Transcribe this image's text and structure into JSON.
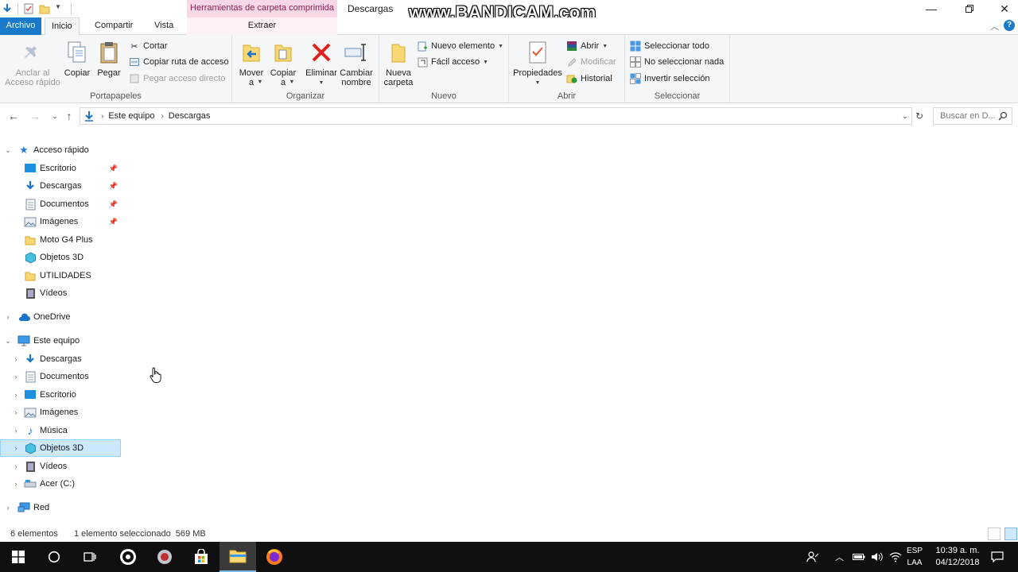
{
  "window": {
    "contextual_header": "Herramientas de carpeta comprimida",
    "title": "Descargas",
    "watermark": "www.BANDICAM.com"
  },
  "tabs": {
    "file": "Archivo",
    "home": "Inicio",
    "share": "Compartir",
    "view": "Vista",
    "extract": "Extraer"
  },
  "ribbon": {
    "clipboard": {
      "label": "Portapapeles",
      "pin": "Anclar al\nAcceso rápido",
      "copy": "Copiar",
      "paste": "Pegar",
      "cut": "Cortar",
      "copy_path": "Copiar ruta de acceso",
      "paste_shortcut": "Pegar acceso directo"
    },
    "organize": {
      "label": "Organizar",
      "move_to": "Mover\na",
      "copy_to": "Copiar\na",
      "delete": "Eliminar",
      "rename": "Cambiar\nnombre"
    },
    "new": {
      "label": "Nuevo",
      "new_folder": "Nueva\ncarpeta",
      "new_item": "Nuevo elemento",
      "easy_access": "Fácil acceso"
    },
    "open": {
      "label": "Abrir",
      "properties": "Propiedades",
      "open": "Abrir",
      "edit": "Modificar",
      "history": "Historial"
    },
    "select": {
      "label": "Seleccionar",
      "select_all": "Seleccionar todo",
      "select_none": "No seleccionar nada",
      "invert": "Invertir selección"
    }
  },
  "address": {
    "crumbs": [
      "Este equipo",
      "Descargas"
    ],
    "search_placeholder": "Buscar en D..."
  },
  "nav": {
    "quick_access": "Acceso rápido",
    "quick_items": [
      "Escritorio",
      "Descargas",
      "Documentos",
      "Imágenes",
      "Moto G4 Plus",
      "Objetos 3D",
      "UTILIDADES",
      "Vídeos"
    ],
    "onedrive": "OneDrive",
    "this_pc": "Este equipo",
    "pc_items": [
      "Descargas",
      "Documentos",
      "Escritorio",
      "Imágenes",
      "Música",
      "Objetos 3D",
      "Vídeos",
      "Acer (C:)"
    ],
    "network": "Red"
  },
  "status": {
    "count": "6 elementos",
    "selection": "1 elemento seleccionado  569 MB"
  },
  "taskbar": {
    "lang_top": "ESP",
    "lang_bottom": "LAA",
    "time": "10:39 a. m.",
    "date": "04/12/2018"
  }
}
